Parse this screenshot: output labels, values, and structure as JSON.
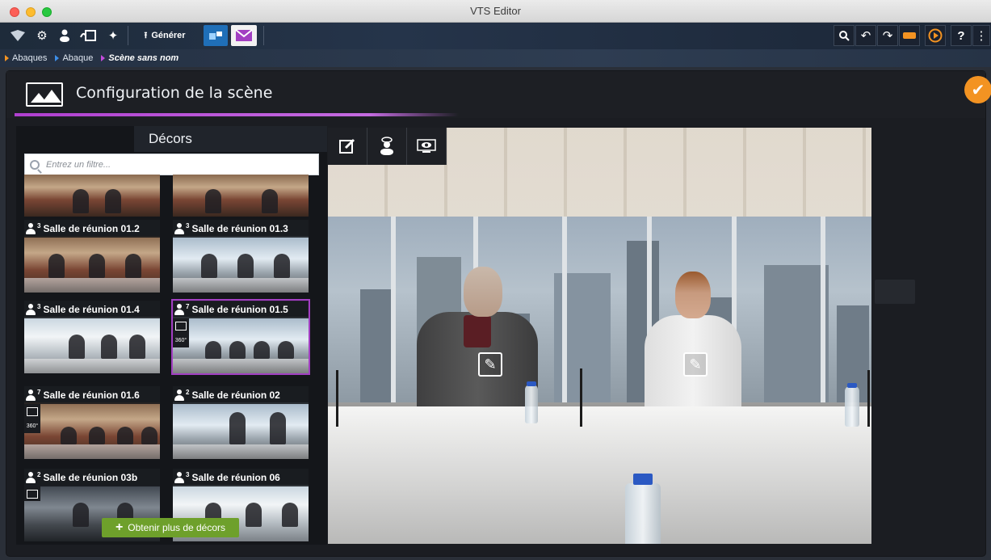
{
  "window": {
    "title": "VTS Editor"
  },
  "toolbar": {
    "generate_label": "Générer",
    "help_label": "?"
  },
  "breadcrumb": {
    "items": [
      {
        "label": "Abaques",
        "color": "#f39322"
      },
      {
        "label": "Abaque",
        "color": "#3d8ee8"
      },
      {
        "label": "Scène sans nom",
        "color": "#c34bdc"
      }
    ]
  },
  "panel": {
    "title": "Configuration de la scène",
    "accent_color": "#b03fd0",
    "confirm_color": "#f39322"
  },
  "decors": {
    "title": "Décors",
    "filter_placeholder": "Entrez un filtre...",
    "more_button_label": "Obtenir plus de décors",
    "more_button_color": "#6ea02b",
    "items": [
      {
        "label": "",
        "capacity": ""
      },
      {
        "label": "",
        "capacity": ""
      },
      {
        "label": "Salle de réunion 01.2",
        "capacity": "3"
      },
      {
        "label": "Salle de réunion 01.3",
        "capacity": "3"
      },
      {
        "label": "Salle de réunion 01.4",
        "capacity": "3"
      },
      {
        "label": "Salle de réunion 01.5",
        "capacity": "7",
        "images": "1",
        "selected": true
      },
      {
        "label": "Salle de réunion 01.6",
        "capacity": "7",
        "images": "1"
      },
      {
        "label": "Salle de réunion 02",
        "capacity": "2"
      },
      {
        "label": "Salle de réunion 03b",
        "capacity": "2",
        "images": "1"
      },
      {
        "label": "Salle de réunion 06",
        "capacity": "3"
      }
    ]
  },
  "preview": {
    "tools": [
      "edit-icon",
      "character-view-icon",
      "preview-eye-icon"
    ]
  }
}
